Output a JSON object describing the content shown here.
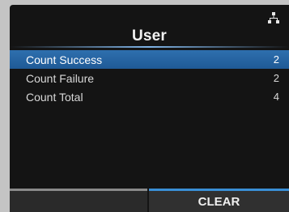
{
  "screen": {
    "title": "User",
    "icons": {
      "network": "network-icon"
    },
    "items": [
      {
        "label": "Count Success",
        "value": "2",
        "selected": true
      },
      {
        "label": "Count Failure",
        "value": "2",
        "selected": false
      },
      {
        "label": "Count Total",
        "value": "4",
        "selected": false
      }
    ],
    "softkeys": {
      "left_label": "",
      "right_label": "CLEAR"
    },
    "colors": {
      "background": "#141414",
      "selection": "#2a6aa8",
      "accent": "#3a8fd6"
    }
  }
}
